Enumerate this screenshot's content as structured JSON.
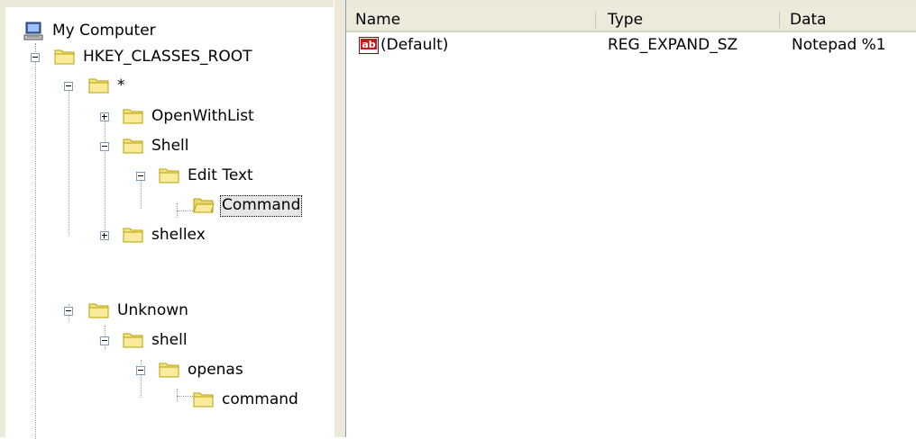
{
  "tree": {
    "root": {
      "label": "My Computer",
      "icon": "computer-icon"
    },
    "nodes": [
      {
        "id": "hkcr",
        "label": "HKEY_CLASSES_ROOT",
        "expander": "minus"
      },
      {
        "id": "star",
        "label": "*",
        "expander": "minus"
      },
      {
        "id": "openwithlist",
        "label": "OpenWithList",
        "expander": "plus"
      },
      {
        "id": "shell1",
        "label": "Shell",
        "expander": "minus"
      },
      {
        "id": "edittext",
        "label": "Edit Text",
        "expander": "minus"
      },
      {
        "id": "command1",
        "label": "Command",
        "selected": true
      },
      {
        "id": "shellex",
        "label": "shellex",
        "expander": "plus"
      },
      {
        "id": "unknown",
        "label": "Unknown",
        "expander": "minus"
      },
      {
        "id": "shell2",
        "label": "shell",
        "expander": "minus"
      },
      {
        "id": "openas",
        "label": "openas",
        "expander": "minus"
      },
      {
        "id": "command2",
        "label": "command"
      }
    ]
  },
  "list": {
    "columns": [
      "Name",
      "Type",
      "Data"
    ],
    "rows": [
      {
        "name": "(Default)",
        "type": "REG_EXPAND_SZ",
        "data": "Notepad %1",
        "icon": "ab-string-icon"
      }
    ]
  },
  "colors": {
    "chrome": "#ece9d8",
    "folder": "#f4e48a",
    "folder_outline": "#b8a000",
    "selection_bg": "#e6e6e6"
  }
}
